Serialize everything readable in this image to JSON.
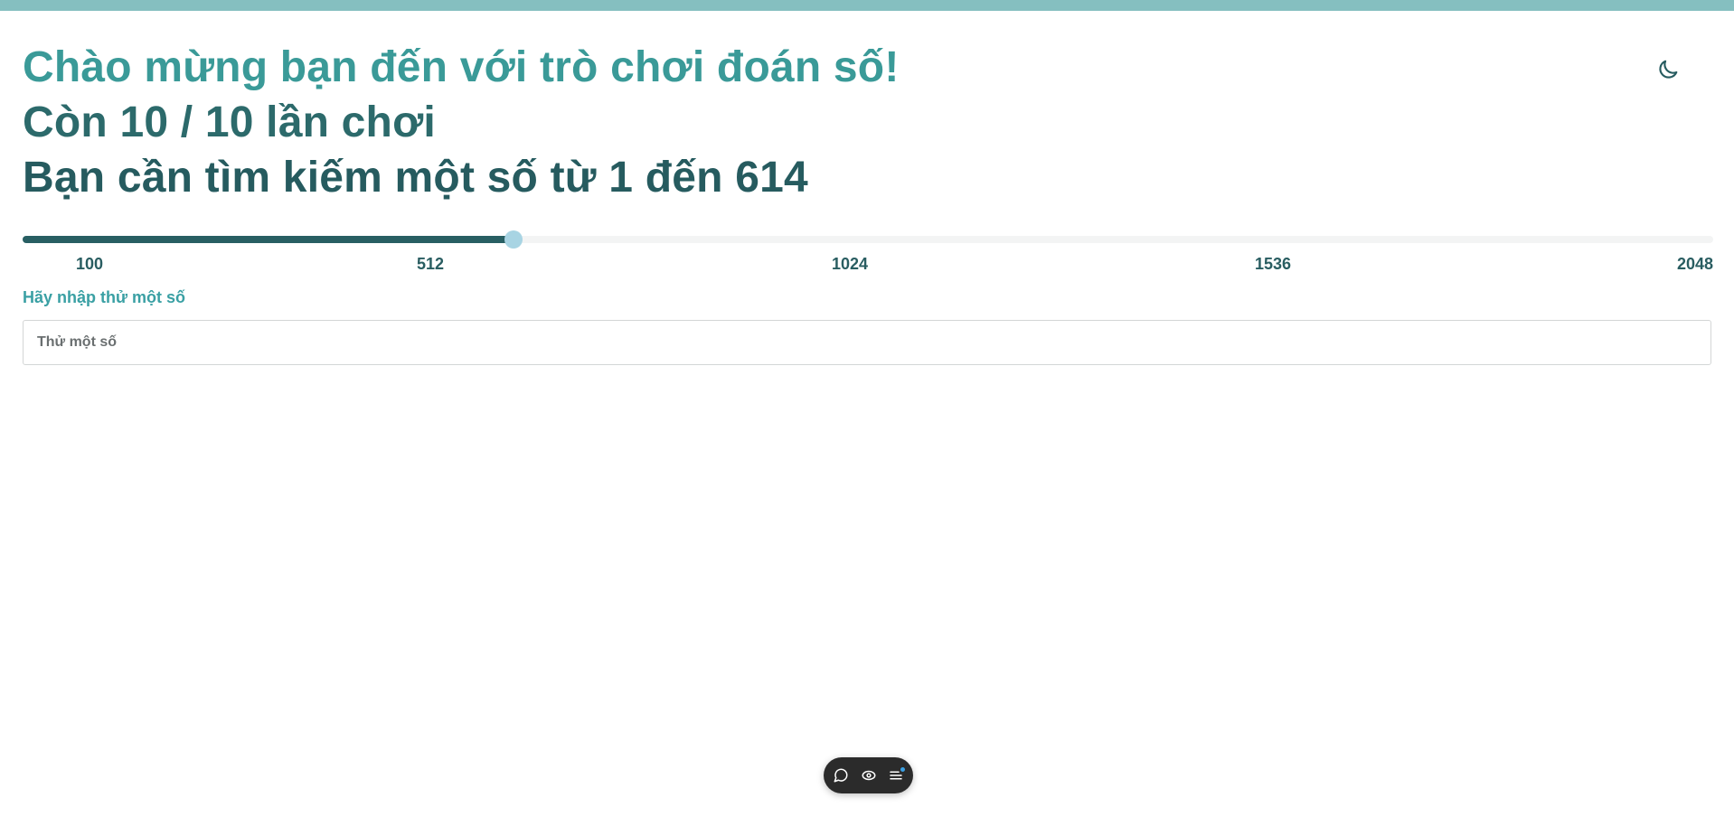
{
  "colors": {
    "accent": "#3a9a98",
    "dark_teal": "#265b5f",
    "top_bar": "#85bfc0",
    "slider_fill": "#285f63",
    "slider_thumb": "#a8d4e3",
    "toolbar_bg": "#2b2b2b"
  },
  "header": {
    "welcome": "Chào mừng bạn đến với trò chơi đoán số!",
    "turns": "Còn 10 / 10 lần chơi",
    "range_text": "Bạn cần tìm kiếm một số từ 1 đến 614",
    "theme_toggle_icon": "moon-icon"
  },
  "slider": {
    "min": 100,
    "max": 2048,
    "value": 614,
    "ticks": [
      "100",
      "512",
      "1024",
      "1536",
      "2048"
    ]
  },
  "guess": {
    "label": "Hãy nhập thử một số",
    "placeholder": "Thử một số",
    "value": ""
  },
  "floating_toolbar": {
    "icons": [
      "chat-bubble-icon",
      "eye-icon",
      "menu-list-icon"
    ]
  }
}
